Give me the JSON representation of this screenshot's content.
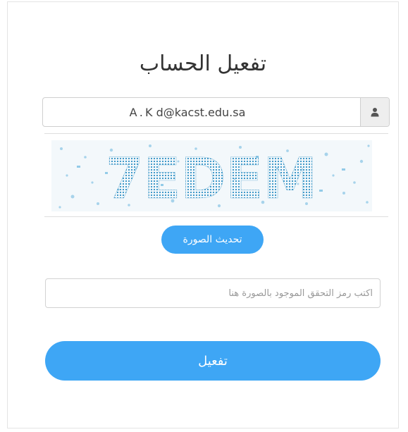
{
  "form": {
    "title": "تفعيل الحساب",
    "email_value": "A . K d@kacst.edu.sa",
    "captcha_text": "7EDEM",
    "refresh_label": "تحديث الصورة",
    "code_placeholder": "اكتب رمز التحقق الموجود بالصورة هنا",
    "activate_label": "تفعيل"
  },
  "icons": {
    "user": "user-icon"
  },
  "colors": {
    "accent": "#3ea6f5",
    "captcha_ink": "#2d8fc4"
  }
}
